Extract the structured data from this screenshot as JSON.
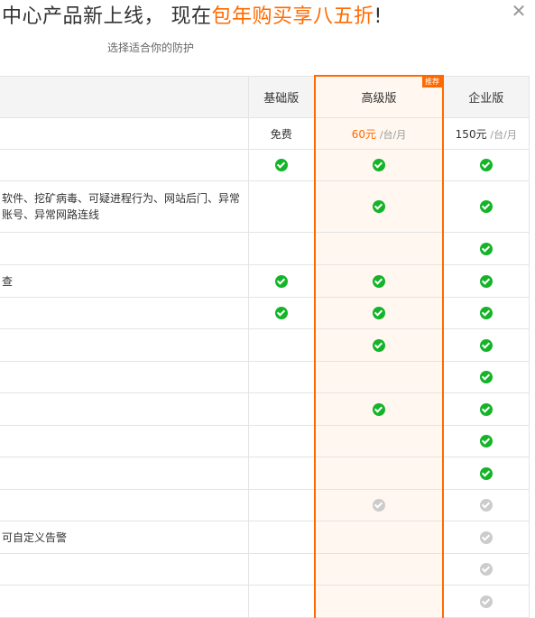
{
  "header": {
    "title_prefix": "中心产品新上线，  现在",
    "title_highlight": "包年购买享八五折",
    "title_suffix": "!",
    "subtitle": "选择适合你的防护",
    "close_icon": "close-icon"
  },
  "plans": {
    "basic": "基础版",
    "advanced": "高级版",
    "enterprise": "企业版",
    "badge": "推荐"
  },
  "prices": {
    "basic": "免费",
    "advanced_amount": "60元",
    "advanced_unit": "/台/月",
    "enterprise_amount": "150元",
    "enterprise_unit": "/台/月"
  },
  "rows": [
    {
      "feature": "",
      "basic": "on",
      "advanced": "on",
      "enterprise": "on"
    },
    {
      "feature": "软件、挖矿病毒、可疑进程行为、网站后门、异常账号、异常网路连线",
      "basic": "",
      "advanced": "on",
      "enterprise": "on"
    },
    {
      "feature": "",
      "basic": "",
      "advanced": "",
      "enterprise": "on"
    },
    {
      "feature": "查",
      "basic": "on",
      "advanced": "on",
      "enterprise": "on"
    },
    {
      "feature": "",
      "basic": "on",
      "advanced": "on",
      "enterprise": "on"
    },
    {
      "feature": "",
      "basic": "",
      "advanced": "on",
      "enterprise": "on"
    },
    {
      "feature": "",
      "basic": "",
      "advanced": "",
      "enterprise": "on"
    },
    {
      "feature": "",
      "basic": "",
      "advanced": "on",
      "enterprise": "on"
    },
    {
      "feature": "",
      "basic": "",
      "advanced": "",
      "enterprise": "on"
    },
    {
      "feature": "",
      "basic": "",
      "advanced": "",
      "enterprise": "on"
    },
    {
      "feature": "",
      "basic": "",
      "advanced": "off",
      "enterprise": "off"
    },
    {
      "feature": "可自定义告警",
      "basic": "",
      "advanced": "",
      "enterprise": "off"
    },
    {
      "feature": "",
      "basic": "",
      "advanced": "",
      "enterprise": "off"
    },
    {
      "feature": "",
      "basic": "",
      "advanced": "",
      "enterprise": "off"
    }
  ],
  "colors": {
    "accent": "#ff6a00",
    "check_on": "#14b428",
    "check_off": "#cccccc",
    "recommended_bg": "#fff7f0"
  }
}
